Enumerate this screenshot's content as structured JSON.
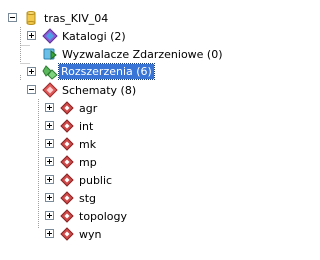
{
  "tree": {
    "root": {
      "label": "tras_KIV_04",
      "icon": "database-cylinder-icon",
      "expanded": true
    },
    "items": [
      {
        "label": "Katalogi (2)",
        "icon": "catalog-diamond-icon",
        "expanded": false
      },
      {
        "label": "Wyzwalacze Zdarzeniowe (0)",
        "icon": "event-trigger-icon"
      },
      {
        "label": "Rozszerzenia (6)",
        "icon": "extensions-icon",
        "expanded": false,
        "selected": true
      },
      {
        "label": "Schematy (8)",
        "icon": "schemas-icon",
        "expanded": true
      }
    ],
    "schemas": [
      {
        "label": "agr",
        "icon": "schema-icon"
      },
      {
        "label": "int",
        "icon": "schema-icon"
      },
      {
        "label": "mk",
        "icon": "schema-icon"
      },
      {
        "label": "mp",
        "icon": "schema-icon"
      },
      {
        "label": "public",
        "icon": "schema-icon"
      },
      {
        "label": "stg",
        "icon": "schema-icon"
      },
      {
        "label": "topology",
        "icon": "schema-icon"
      },
      {
        "label": "wyn",
        "icon": "schema-icon"
      }
    ],
    "colors": {
      "selection": "#3875d7",
      "lines": "#a0a0a0",
      "schema_red": "#d04a4a"
    }
  }
}
